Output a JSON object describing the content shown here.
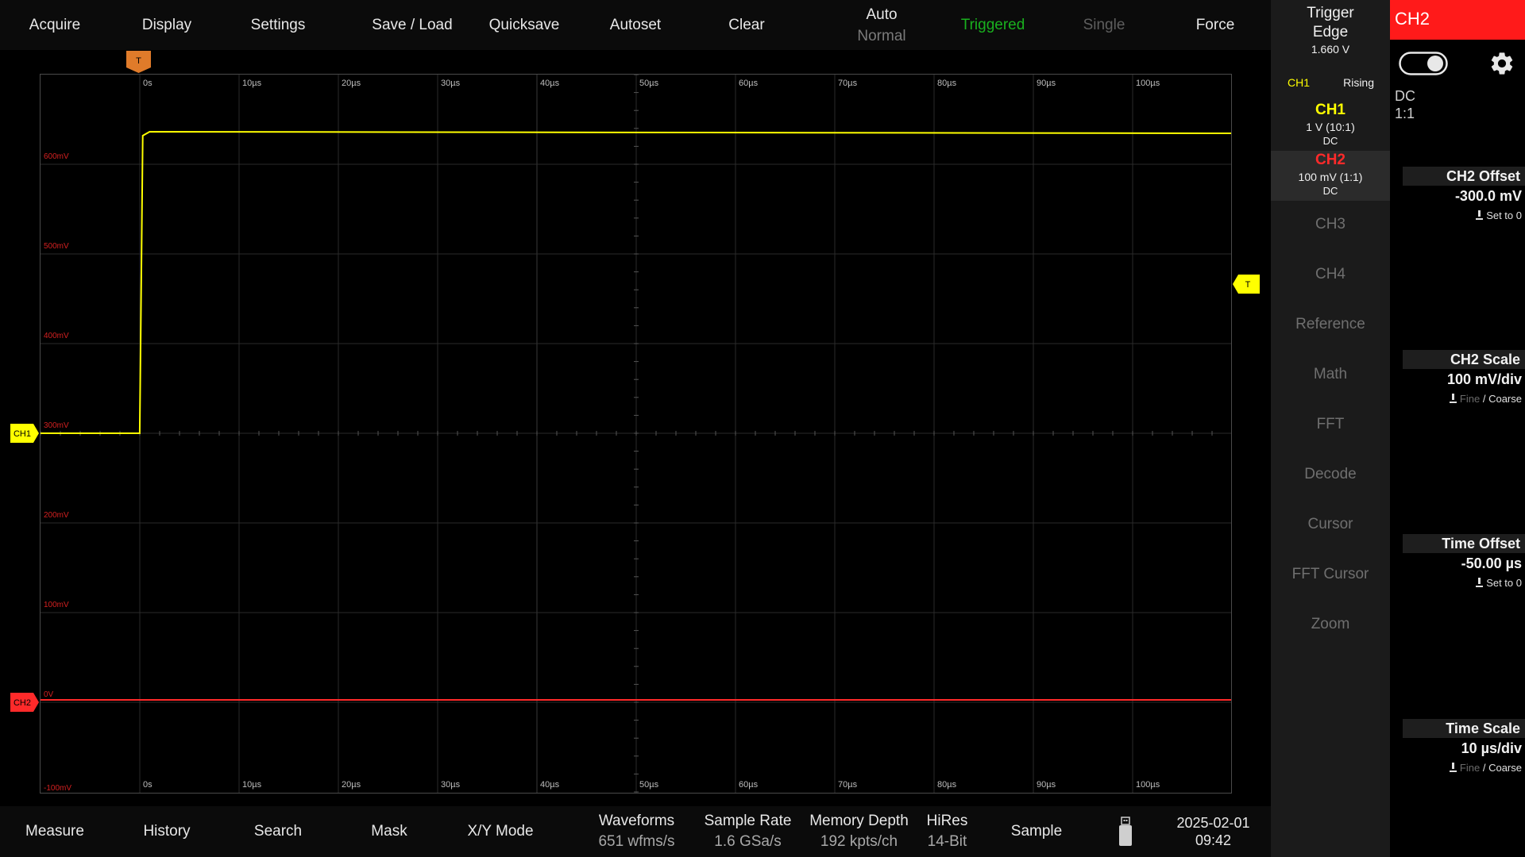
{
  "topbar": {
    "acquire": "Acquire",
    "display": "Display",
    "settings": "Settings",
    "save_load": "Save / Load",
    "quicksave": "Quicksave",
    "autoset": "Autoset",
    "clear": "Clear",
    "mode_auto": "Auto",
    "mode_normal": "Normal",
    "triggered": "Triggered",
    "single": "Single",
    "force": "Force"
  },
  "colors": {
    "ch1": "#ffff00",
    "ch2": "#ff2a2a",
    "trigger_marker": "#e07b2a",
    "triggered": "#19b01e"
  },
  "trigger": {
    "title": "Trigger",
    "type": "Edge",
    "level": "1.660 V",
    "source": "CH1",
    "slope": "Rising"
  },
  "channels": {
    "ch1": {
      "name": "CH1",
      "scale": "1 V (10:1)",
      "coupling": "DC"
    },
    "ch2": {
      "name": "CH2",
      "scale": "100 mV (1:1)",
      "coupling": "DC"
    }
  },
  "sidebar_menu": [
    "CH3",
    "CH4",
    "Reference",
    "Math",
    "FFT",
    "Decode",
    "Cursor",
    "FFT Cursor",
    "Zoom"
  ],
  "right_panel": {
    "title": "CH2",
    "toggle_on": true,
    "toggle_icon": "toggle-icon",
    "settings_icon": "gear-icon",
    "coupling": "DC",
    "probe": "1:1",
    "ch2_offset": {
      "label": "CH2 Offset",
      "value": "-300.0 mV",
      "hint": "Set to 0"
    },
    "ch2_scale": {
      "label": "CH2 Scale",
      "value": "100 mV/div",
      "fine": "Fine",
      "sep": "/",
      "coarse": "Coarse"
    },
    "time_offset": {
      "label": "Time Offset",
      "value": "-50.00 µs",
      "hint": "Set to 0"
    },
    "time_scale": {
      "label": "Time Scale",
      "value": "10 µs/div",
      "fine": "Fine",
      "sep": "/",
      "coarse": "Coarse"
    }
  },
  "plot": {
    "x_labels": [
      "0s",
      "10µs",
      "20µs",
      "30µs",
      "40µs",
      "50µs",
      "60µs",
      "70µs",
      "80µs",
      "90µs",
      "100µs"
    ],
    "y_labels": [
      "600mV",
      "500mV",
      "400mV",
      "300mV",
      "200mV",
      "100mV",
      "0V",
      "-100mV"
    ],
    "ch1_marker": "CH1",
    "ch2_marker": "CH2",
    "trigger_marker": "T",
    "trigger_level_marker": "T"
  },
  "chart_data": {
    "type": "line",
    "x_unit": "µs",
    "xlim": [
      -10,
      110
    ],
    "y_unit": "mV",
    "ylim": [
      -100,
      700
    ],
    "grid": true,
    "series": [
      {
        "name": "CH1",
        "x": [
          -10,
          0,
          0.3,
          1,
          110
        ],
        "y": [
          300,
          300,
          675,
          680,
          678
        ]
      },
      {
        "name": "CH2",
        "x": [
          -10,
          110
        ],
        "y": [
          -5,
          -5
        ]
      }
    ]
  },
  "bottombar": {
    "measure": "Measure",
    "history": "History",
    "search": "Search",
    "mask": "Mask",
    "xy_mode": "X/Y Mode",
    "waveforms_label": "Waveforms",
    "waveforms_value": "651 wfms/s",
    "sample_rate_label": "Sample Rate",
    "sample_rate_value": "1.6 GSa/s",
    "memory_label": "Memory Depth",
    "memory_value": "192 kpts/ch",
    "hires_label": "HiRes",
    "hires_value": "14-Bit",
    "acq_mode": "Sample",
    "usb_icon": "usb-drive-icon",
    "date": "2025-02-01",
    "time": "09:42"
  }
}
